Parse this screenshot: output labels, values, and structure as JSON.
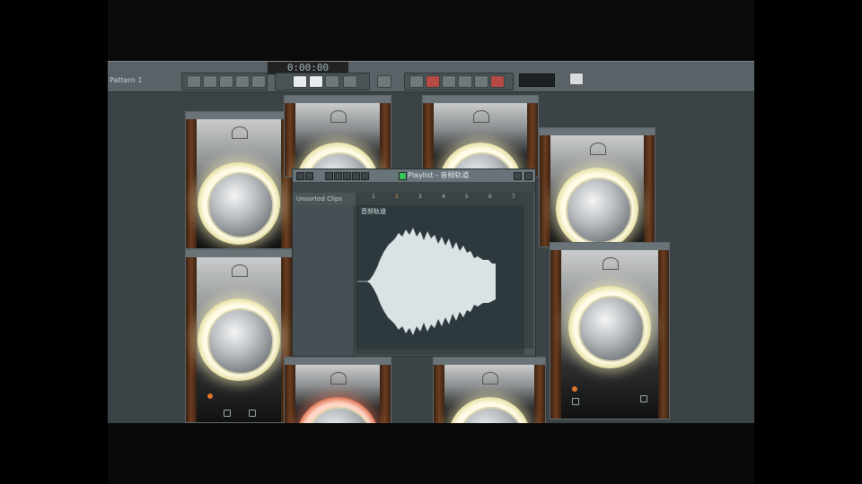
{
  "toolbar": {
    "time_display": "0:00:00",
    "pattern_label": "Pattern 1"
  },
  "playlist": {
    "title": "Playlist - 音频轨道",
    "track_label": "Unsorted Clips",
    "clip_label": "音频轨道",
    "ruler_markers": [
      "1",
      "2",
      "3",
      "4",
      "5",
      "6",
      "7"
    ],
    "current_marker": "2"
  },
  "colors": {
    "workspace": "#3b4346",
    "toolbar": "#596266",
    "knob_glow": "#fff6be",
    "active_ring": "#e07a5a",
    "waveform": "#d9e3e6"
  },
  "plugins": [
    {
      "name": "plugin-window-1",
      "ring": "glow"
    },
    {
      "name": "plugin-window-2",
      "ring": "glow"
    },
    {
      "name": "plugin-window-3",
      "ring": "glow"
    },
    {
      "name": "plugin-window-4",
      "ring": "glow"
    },
    {
      "name": "plugin-window-5",
      "ring": "glow"
    },
    {
      "name": "plugin-window-6",
      "ring": "glow"
    },
    {
      "name": "plugin-window-7",
      "ring": "orange"
    },
    {
      "name": "plugin-window-8",
      "ring": "glow"
    }
  ]
}
